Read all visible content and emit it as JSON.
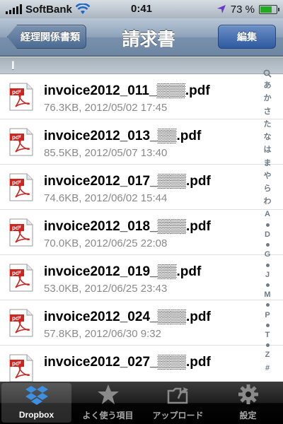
{
  "status_bar": {
    "carrier": "SoftBank",
    "time": "0:41",
    "battery": "73 %",
    "battery_level": 0.73
  },
  "nav": {
    "back_label": "経理関係書類",
    "title": "請求書",
    "edit_label": "編集"
  },
  "section": {
    "header": "I"
  },
  "files": [
    {
      "name": "invoice2012_011_▒▒▒.pdf",
      "meta": "76.3KB, 2012/05/02 17:45",
      "icon": "pdf-icon"
    },
    {
      "name": "invoice2012_013_▒▒.pdf",
      "meta": "85.5KB, 2012/05/07 13:40",
      "icon": "pdf-icon"
    },
    {
      "name": "invoice2012_017_▒▒▒.pdf",
      "meta": "74.6KB, 2012/06/02 15:44",
      "icon": "pdf-icon"
    },
    {
      "name": "invoice2012_018_▒▒▒.pdf",
      "meta": "70.0KB, 2012/06/25 22:08",
      "icon": "pdf-icon"
    },
    {
      "name": "invoice2012_019_▒▒.pdf",
      "meta": "53.0KB, 2012/06/25 23:43",
      "icon": "pdf-icon"
    },
    {
      "name": "invoice2012_024_▒▒▒.pdf",
      "meta": "57.8KB, 2012/06/30 9:32",
      "icon": "pdf-icon"
    },
    {
      "name": "invoice2012_027_▒▒▒.pdf",
      "meta": "",
      "icon": "pdf-icon"
    }
  ],
  "index_items": [
    "search",
    "あ",
    "か",
    "さ",
    "た",
    "な",
    "は",
    "ま",
    "や",
    "ら",
    "わ",
    "A",
    "•",
    "D",
    "•",
    "G",
    "•",
    "J",
    "•",
    "M",
    "•",
    "P",
    "•",
    "T",
    "•",
    "Z",
    "#"
  ],
  "tabs": [
    {
      "label": "Dropbox",
      "icon": "dropbox-icon",
      "selected": true
    },
    {
      "label": "よく使う項目",
      "icon": "star-icon",
      "selected": false
    },
    {
      "label": "アップロード",
      "icon": "upload-icon",
      "selected": false
    },
    {
      "label": "設定",
      "icon": "gear-icon",
      "selected": false
    }
  ],
  "colors": {
    "pdf_red": "#d0231b",
    "nav_blue": "#6d86a3",
    "edit_blue": "#2f5aa0"
  }
}
